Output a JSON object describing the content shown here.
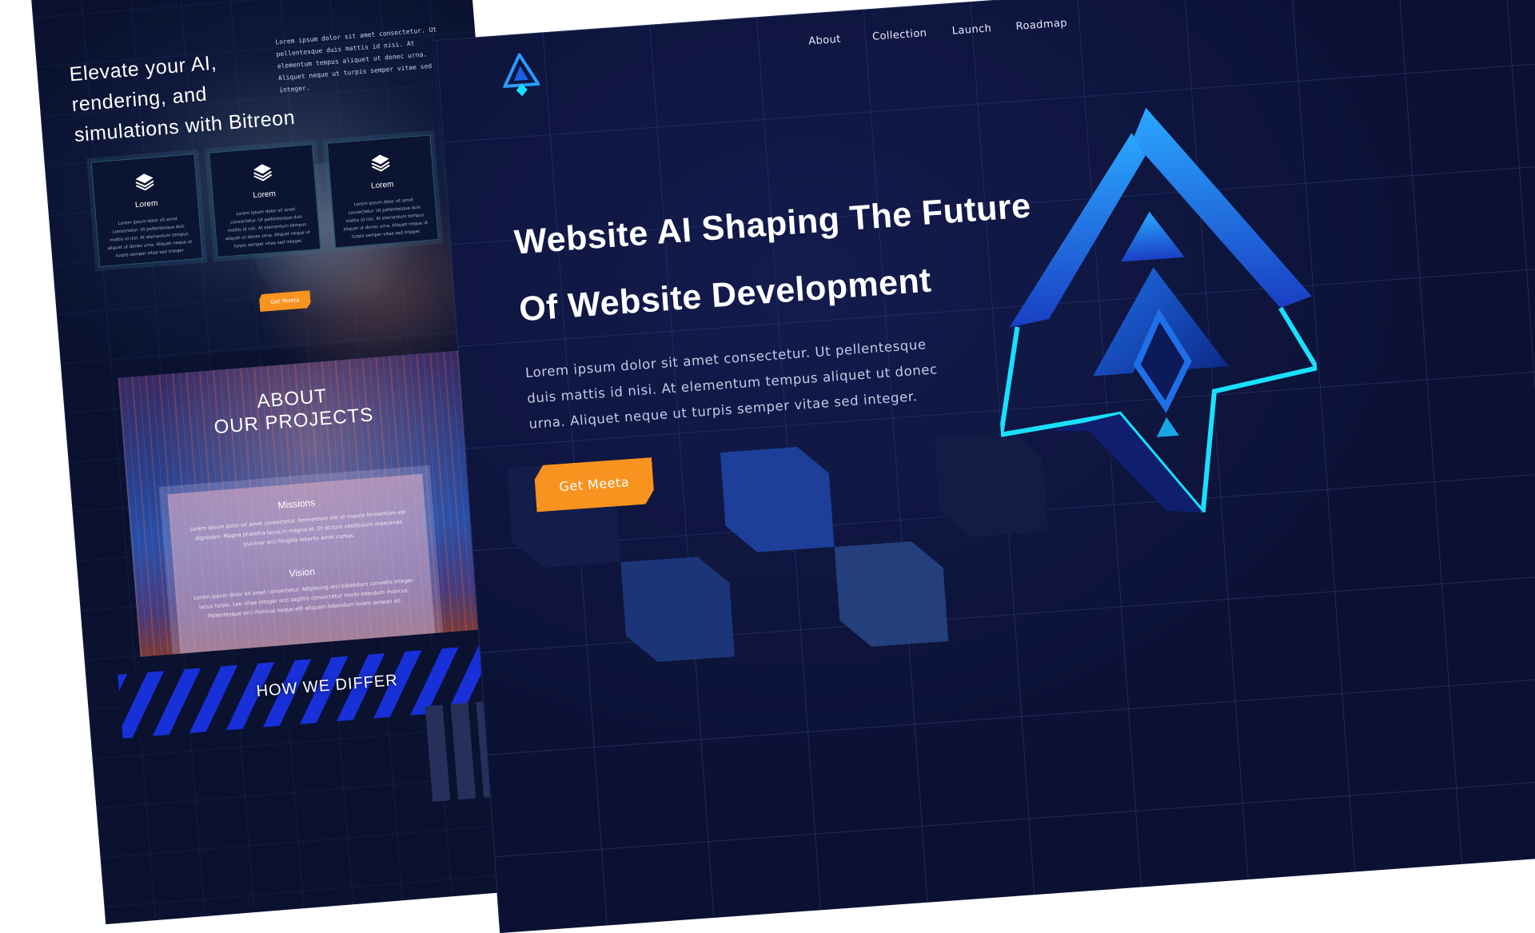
{
  "left_page": {
    "hero": {
      "title": "Elevate your AI, rendering, and simulations with Bitreon",
      "description": "Lorem ipsum dolor sit amet consectetur. Ut pellentesque duis mattis id nisi. At elementum tempus aliquet ut donec urna. Aliquet neque ut turpis semper vitae sed integer."
    },
    "cards": [
      {
        "icon": "layers-icon",
        "title": "Lorem",
        "text": "Lorem ipsum dolor sit amet consectetur. Ut pellentesque duis mattis id nisi. At elementum tempus aliquet ut donec urna. Aliquet neque ut turpis semper vitae sed integer."
      },
      {
        "icon": "layers-icon",
        "title": "Lorem",
        "text": "Lorem ipsum dolor sit amet consectetur. Ut pellentesque duis mattis id nisi. At elementum tempus aliquet ut donec urna. Aliquet neque ut turpis semper vitae sed integer."
      },
      {
        "icon": "layers-icon",
        "title": "Lorem",
        "text": "Lorem ipsum dolor sit amet consectetur. Ut pellentesque duis mattis id nisi. At elementum tempus aliquet ut donec urna. Aliquet neque ut turpis semper vitae sed integer."
      }
    ],
    "cta_label": "Get Meeta",
    "about": {
      "title_line1": "ABOUT",
      "title_line2": "OUR PROJECTS",
      "missions_heading": "Missions",
      "missions_text": "Lorem ipsum dolor sit amet consectetur. Fermentum elit ut mauris fermentum est dignissim. Magna pharetra lacus in magna et. Et dictum vestibulum maecenas pulvinar orci fringilla lobortis amet cursus.",
      "vision_heading": "Vision",
      "vision_text": "Lorem ipsum dolor sit amet consectetur. Adipiscing orci bibendum convallis integer lacus turpis. Leo vitae integer orci sagittis consectetur morbi interdum rhoncus. Pellentesque orci rhoncus neque elit aliquam bibendum lorem aenean sit."
    },
    "differ_title": "HOW WE DIFFER"
  },
  "right_page": {
    "logo": "triangle-logo-icon",
    "nav": [
      "About",
      "Collection",
      "Launch",
      "Roadmap"
    ],
    "hero": {
      "title_line1": "Website AI Shaping The Future",
      "title_line2": "Of Website Development",
      "description": "Lorem ipsum dolor sit amet consectetur. Ut pellentesque duis mattis id nisi. At elementum tempus aliquet ut donec urna. Aliquet neque ut turpis semper vitae sed integer.",
      "cta_label": "Get Meeta"
    },
    "emblem": "triangle-emblem-icon"
  },
  "colors": {
    "background": "#0b1133",
    "accent": "#f7931e",
    "cyan": "#19e0ff",
    "blue": "#1a5fe6",
    "stripe_blue": "#1830d8"
  }
}
